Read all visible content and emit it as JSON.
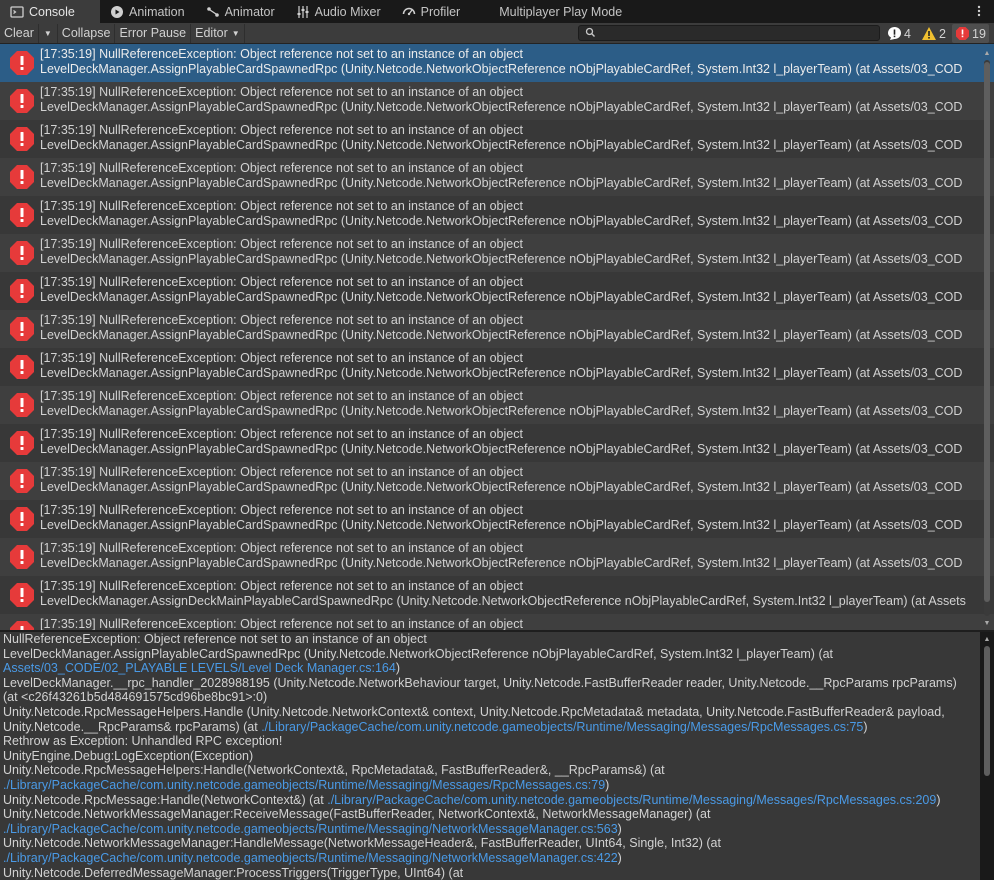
{
  "tabs": [
    {
      "label": "Console",
      "icon": "console-icon",
      "active": true
    },
    {
      "label": "Animation",
      "icon": "animation-icon"
    },
    {
      "label": "Animator",
      "icon": "animator-icon"
    },
    {
      "label": "Audio Mixer",
      "icon": "audio-mixer-icon"
    },
    {
      "label": "Profiler",
      "icon": "profiler-icon"
    },
    {
      "label": "Multiplayer Play Mode",
      "icon": ""
    }
  ],
  "toolbar": {
    "clear": "Clear",
    "collapse": "Collapse",
    "error_pause": "Error Pause",
    "editor": "Editor",
    "search_placeholder": "",
    "info_count": "4",
    "warning_count": "2",
    "error_count": "19"
  },
  "colors": {
    "error_red": "#e63a3a",
    "warning_yellow": "#f0c030",
    "selected_row": "#2c5d87",
    "link_blue": "#4a9ae6"
  },
  "log_rows": [
    {
      "l1": "[17:35:19] NullReferenceException: Object reference not set to an instance of an object",
      "l2": "LevelDeckManager.AssignPlayableCardSpawnedRpc (Unity.Netcode.NetworkObjectReference nObjPlayableCardRef, System.Int32 l_playerTeam) (at Assets/03_COD",
      "selected": true
    },
    {
      "l1": "[17:35:19] NullReferenceException: Object reference not set to an instance of an object",
      "l2": "LevelDeckManager.AssignPlayableCardSpawnedRpc (Unity.Netcode.NetworkObjectReference nObjPlayableCardRef, System.Int32 l_playerTeam) (at Assets/03_COD"
    },
    {
      "l1": "[17:35:19] NullReferenceException: Object reference not set to an instance of an object",
      "l2": "LevelDeckManager.AssignPlayableCardSpawnedRpc (Unity.Netcode.NetworkObjectReference nObjPlayableCardRef, System.Int32 l_playerTeam) (at Assets/03_COD"
    },
    {
      "l1": "[17:35:19] NullReferenceException: Object reference not set to an instance of an object",
      "l2": "LevelDeckManager.AssignPlayableCardSpawnedRpc (Unity.Netcode.NetworkObjectReference nObjPlayableCardRef, System.Int32 l_playerTeam) (at Assets/03_COD"
    },
    {
      "l1": "[17:35:19] NullReferenceException: Object reference not set to an instance of an object",
      "l2": "LevelDeckManager.AssignPlayableCardSpawnedRpc (Unity.Netcode.NetworkObjectReference nObjPlayableCardRef, System.Int32 l_playerTeam) (at Assets/03_COD"
    },
    {
      "l1": "[17:35:19] NullReferenceException: Object reference not set to an instance of an object",
      "l2": "LevelDeckManager.AssignPlayableCardSpawnedRpc (Unity.Netcode.NetworkObjectReference nObjPlayableCardRef, System.Int32 l_playerTeam) (at Assets/03_COD"
    },
    {
      "l1": "[17:35:19] NullReferenceException: Object reference not set to an instance of an object",
      "l2": "LevelDeckManager.AssignPlayableCardSpawnedRpc (Unity.Netcode.NetworkObjectReference nObjPlayableCardRef, System.Int32 l_playerTeam) (at Assets/03_COD"
    },
    {
      "l1": "[17:35:19] NullReferenceException: Object reference not set to an instance of an object",
      "l2": "LevelDeckManager.AssignPlayableCardSpawnedRpc (Unity.Netcode.NetworkObjectReference nObjPlayableCardRef, System.Int32 l_playerTeam) (at Assets/03_COD"
    },
    {
      "l1": "[17:35:19] NullReferenceException: Object reference not set to an instance of an object",
      "l2": "LevelDeckManager.AssignPlayableCardSpawnedRpc (Unity.Netcode.NetworkObjectReference nObjPlayableCardRef, System.Int32 l_playerTeam) (at Assets/03_COD"
    },
    {
      "l1": "[17:35:19] NullReferenceException: Object reference not set to an instance of an object",
      "l2": "LevelDeckManager.AssignPlayableCardSpawnedRpc (Unity.Netcode.NetworkObjectReference nObjPlayableCardRef, System.Int32 l_playerTeam) (at Assets/03_COD"
    },
    {
      "l1": "[17:35:19] NullReferenceException: Object reference not set to an instance of an object",
      "l2": "LevelDeckManager.AssignPlayableCardSpawnedRpc (Unity.Netcode.NetworkObjectReference nObjPlayableCardRef, System.Int32 l_playerTeam) (at Assets/03_COD"
    },
    {
      "l1": "[17:35:19] NullReferenceException: Object reference not set to an instance of an object",
      "l2": "LevelDeckManager.AssignPlayableCardSpawnedRpc (Unity.Netcode.NetworkObjectReference nObjPlayableCardRef, System.Int32 l_playerTeam) (at Assets/03_COD"
    },
    {
      "l1": "[17:35:19] NullReferenceException: Object reference not set to an instance of an object",
      "l2": "LevelDeckManager.AssignPlayableCardSpawnedRpc (Unity.Netcode.NetworkObjectReference nObjPlayableCardRef, System.Int32 l_playerTeam) (at Assets/03_COD"
    },
    {
      "l1": "[17:35:19] NullReferenceException: Object reference not set to an instance of an object",
      "l2": "LevelDeckManager.AssignPlayableCardSpawnedRpc (Unity.Netcode.NetworkObjectReference nObjPlayableCardRef, System.Int32 l_playerTeam) (at Assets/03_COD"
    },
    {
      "l1": "[17:35:19] NullReferenceException: Object reference not set to an instance of an object",
      "l2": "LevelDeckManager.AssignDeckMainPlayableCardSpawnedRpc (Unity.Netcode.NetworkObjectReference nObjPlayableCardRef, System.Int32 l_playerTeam) (at Assets"
    },
    {
      "l1": "[17:35:19] NullReferenceException: Object reference not set to an instance of an object",
      "l2": ""
    }
  ],
  "detail_lines": [
    [
      {
        "t": "NullReferenceException: Object reference not set to an instance of an object"
      }
    ],
    [
      {
        "t": "LevelDeckManager.AssignPlayableCardSpawnedRpc (Unity.Netcode.NetworkObjectReference nObjPlayableCardRef, System.Int32 l_playerTeam) (at"
      }
    ],
    [
      {
        "t": "Assets/03_CODE/02_PLAYABLE LEVELS/Level Deck Manager.cs:164",
        "link": true
      },
      {
        "t": ")"
      }
    ],
    [
      {
        "t": "LevelDeckManager.__rpc_handler_2028988195 (Unity.Netcode.NetworkBehaviour target, Unity.Netcode.FastBufferReader reader, Unity.Netcode.__RpcParams rpcParams)"
      }
    ],
    [
      {
        "t": "(at <c26f43261b5d484691575cd96be8bc91>:0)"
      }
    ],
    [
      {
        "t": "Unity.Netcode.RpcMessageHelpers.Handle (Unity.Netcode.NetworkContext& context, Unity.Netcode.RpcMetadata& metadata, Unity.Netcode.FastBufferReader& payload,"
      }
    ],
    [
      {
        "t": "Unity.Netcode.__RpcParams& rpcParams) (at "
      },
      {
        "t": "./Library/PackageCache/com.unity.netcode.gameobjects/Runtime/Messaging/Messages/RpcMessages.cs:75",
        "link": true
      },
      {
        "t": ")"
      }
    ],
    [
      {
        "t": "Rethrow as Exception: Unhandled RPC exception!"
      }
    ],
    [
      {
        "t": "UnityEngine.Debug:LogException(Exception)"
      }
    ],
    [
      {
        "t": "Unity.Netcode.RpcMessageHelpers:Handle(NetworkContext&, RpcMetadata&, FastBufferReader&, __RpcParams&) (at"
      }
    ],
    [
      {
        "t": "./Library/PackageCache/com.unity.netcode.gameobjects/Runtime/Messaging/Messages/RpcMessages.cs:79",
        "link": true
      },
      {
        "t": ")"
      }
    ],
    [
      {
        "t": "Unity.Netcode.RpcMessage:Handle(NetworkContext&) (at "
      },
      {
        "t": "./Library/PackageCache/com.unity.netcode.gameobjects/Runtime/Messaging/Messages/RpcMessages.cs:209",
        "link": true
      },
      {
        "t": ")"
      }
    ],
    [
      {
        "t": "Unity.Netcode.NetworkMessageManager:ReceiveMessage(FastBufferReader, NetworkContext&, NetworkMessageManager) (at"
      }
    ],
    [
      {
        "t": "./Library/PackageCache/com.unity.netcode.gameobjects/Runtime/Messaging/NetworkMessageManager.cs:563",
        "link": true
      },
      {
        "t": ")"
      }
    ],
    [
      {
        "t": "Unity.Netcode.NetworkMessageManager:HandleMessage(NetworkMessageHeader&, FastBufferReader, UInt64, Single, Int32) (at"
      }
    ],
    [
      {
        "t": "./Library/PackageCache/com.unity.netcode.gameobjects/Runtime/Messaging/NetworkMessageManager.cs:422",
        "link": true
      },
      {
        "t": ")"
      }
    ],
    [
      {
        "t": "Unity.Netcode.DeferredMessageManager:ProcessTriggers(TriggerType, UInt64) (at"
      }
    ]
  ]
}
